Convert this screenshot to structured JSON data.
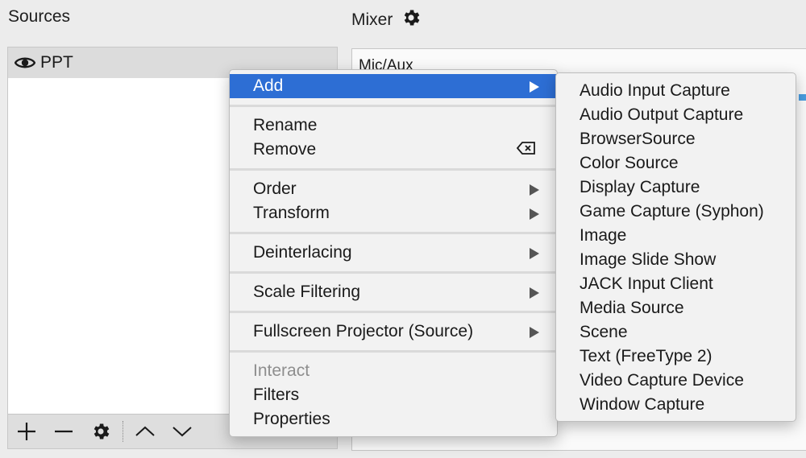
{
  "sources": {
    "title": "Sources",
    "items": [
      {
        "label": "PPT",
        "icon": "eye-icon"
      }
    ],
    "toolbar": [
      "add-icon",
      "remove-icon",
      "gear-icon",
      "move-up-icon",
      "move-down-icon"
    ]
  },
  "mixer": {
    "title": "Mixer",
    "settings_icon": "gear-icon",
    "channel_label": "Mic/Aux"
  },
  "context_menu": {
    "add": "Add",
    "rename": "Rename",
    "remove": "Remove",
    "remove_shortcut": "⌫",
    "order": "Order",
    "transform": "Transform",
    "deinterlacing": "Deinterlacing",
    "scale_filtering": "Scale Filtering",
    "fullscreen_projector": "Fullscreen Projector (Source)",
    "interact": "Interact",
    "filters": "Filters",
    "properties": "Properties"
  },
  "add_submenu": {
    "items": [
      "Audio Input Capture",
      "Audio Output Capture",
      "BrowserSource",
      "Color Source",
      "Display Capture",
      "Game Capture (Syphon)",
      "Image",
      "Image Slide Show",
      "JACK Input Client",
      "Media Source",
      "Scene",
      "Text (FreeType 2)",
      "Video Capture Device",
      "Window Capture"
    ]
  },
  "colors": {
    "highlight": "#2d6ed4",
    "background": "#ececec",
    "menu": "#f2f2f2",
    "meter": "#4a9de0"
  }
}
